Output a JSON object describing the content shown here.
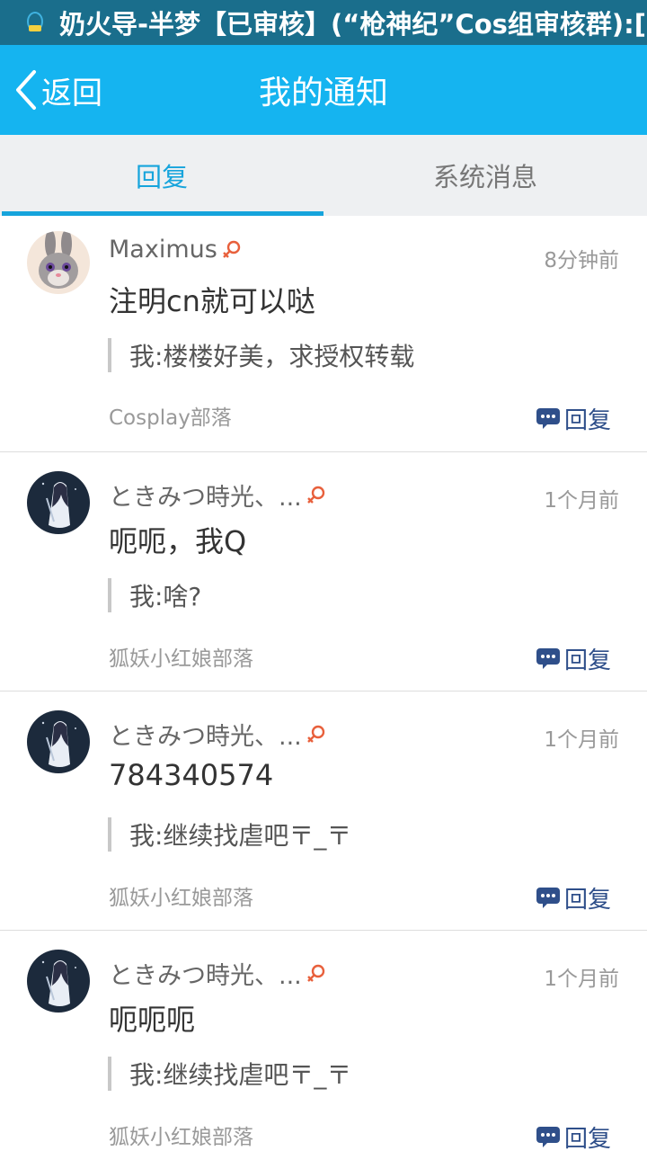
{
  "status_bar": {
    "notification_text": "奶火导-半梦【已审核】(“枪神纪”Cos组审核群):[图",
    "icon": "qq-notification-icon"
  },
  "header": {
    "back_label": "返回",
    "title": "我的通知"
  },
  "tabs": [
    {
      "label": "回复",
      "active": true
    },
    {
      "label": "系统消息",
      "active": false
    }
  ],
  "colors": {
    "header_bg": "#15b4f0",
    "status_bar_bg": "#1a6e8c",
    "accent": "#16a4dc",
    "reply_icon": "#2f4f8a",
    "gender_icon": "#e8603c"
  },
  "notifications": [
    {
      "username": "Maximus",
      "gender_icon": "female-icon",
      "time": "8分钟前",
      "message": "注明cn就可以哒",
      "quote": "我:楼楼好美，求授权转载",
      "source": "Cosplay部落",
      "reply_label": "回复",
      "avatar": "rabbit-avatar"
    },
    {
      "username": "ときみつ時光、...",
      "gender_icon": "female-icon",
      "time": "1个月前",
      "message": "呃呃，我Q",
      "quote": "我:啥?",
      "source": "狐妖小红娘部落",
      "reply_label": "回复",
      "avatar": "anime-girl-avatar"
    },
    {
      "username": "ときみつ時光、...",
      "gender_icon": "female-icon",
      "time": "1个月前",
      "message": "784340574",
      "quote": "我:继续找虐吧〒_〒",
      "source": "狐妖小红娘部落",
      "reply_label": "回复",
      "avatar": "anime-girl-avatar"
    },
    {
      "username": "ときみつ時光、...",
      "gender_icon": "female-icon",
      "time": "1个月前",
      "message": "呃呃呃",
      "quote": "我:继续找虐吧〒_〒",
      "source": "狐妖小红娘部落",
      "reply_label": "回复",
      "avatar": "anime-girl-avatar"
    }
  ]
}
